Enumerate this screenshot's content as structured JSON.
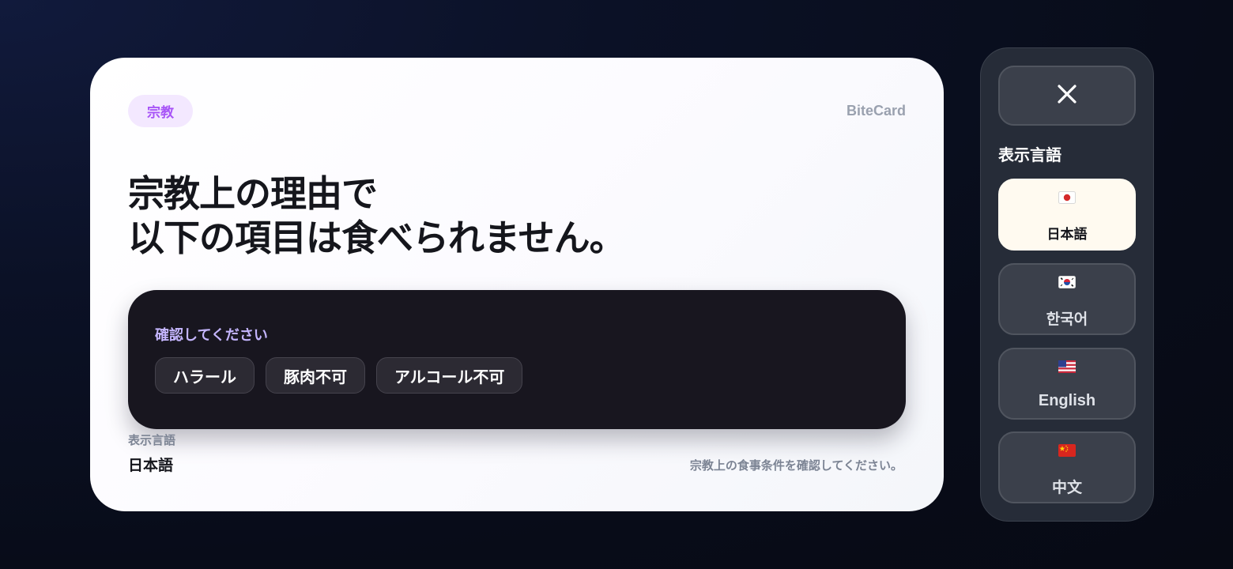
{
  "card": {
    "tag": "宗教",
    "brand": "BiteCard",
    "headline_line1": "宗教上の理由で",
    "headline_line2": "以下の項目は食べられません。",
    "confirm_label": "確認してください",
    "chips": [
      "ハラール",
      "豚肉不可",
      "アルコール不可"
    ],
    "language_caption": "表示言語",
    "language_value": "日本語",
    "footnote": "宗教上の食事条件を確認してください。"
  },
  "panel": {
    "close_icon": "close-icon",
    "title": "表示言語",
    "languages": [
      {
        "label": "日本語",
        "flag": "flag-japan-icon",
        "selected": true
      },
      {
        "label": "한국어",
        "flag": "flag-korea-icon",
        "selected": false
      },
      {
        "label": "English",
        "flag": "flag-usa-icon",
        "selected": false
      },
      {
        "label": "中文",
        "flag": "flag-china-icon",
        "selected": false
      }
    ]
  },
  "colors": {
    "tag_bg": "#f3e8ff",
    "tag_text": "#a855f7",
    "confirm_label": "#c4b5fd",
    "dark_box": "#18161f",
    "active_language_bg": "#fffaf0",
    "panel_bg": "#262c38"
  }
}
